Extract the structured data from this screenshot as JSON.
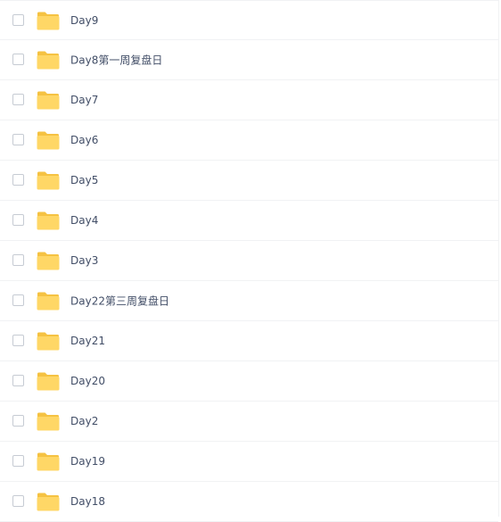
{
  "folders": [
    {
      "name": "Day9",
      "icon": "folder-icon"
    },
    {
      "name": "Day8第一周复盘日",
      "icon": "folder-icon"
    },
    {
      "name": "Day7",
      "icon": "folder-icon"
    },
    {
      "name": "Day6",
      "icon": "folder-icon"
    },
    {
      "name": "Day5",
      "icon": "folder-icon"
    },
    {
      "name": "Day4",
      "icon": "folder-icon"
    },
    {
      "name": "Day3",
      "icon": "folder-icon"
    },
    {
      "name": "Day22第三周复盘日",
      "icon": "folder-icon"
    },
    {
      "name": "Day21",
      "icon": "folder-icon"
    },
    {
      "name": "Day20",
      "icon": "folder-icon"
    },
    {
      "name": "Day2",
      "icon": "folder-icon"
    },
    {
      "name": "Day19",
      "icon": "folder-icon"
    },
    {
      "name": "Day18",
      "icon": "folder-icon"
    }
  ],
  "colors": {
    "folder_body": "#ffd766",
    "folder_back": "#f5c242",
    "text": "#424e67",
    "divider": "#f1f2f4",
    "checkbox_border": "#c6cbd3"
  }
}
